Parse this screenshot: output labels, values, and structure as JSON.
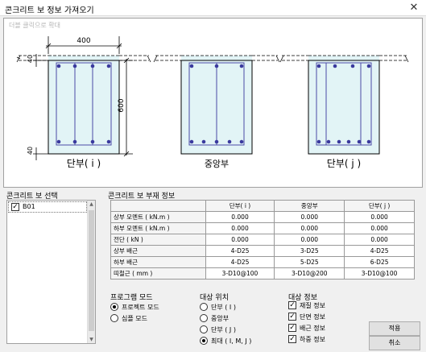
{
  "window": {
    "title": "콘크리트 보 정보 가져오기",
    "close_glyph": "✕"
  },
  "drawing": {
    "hint": "더블 클릭으로 확대",
    "sections": [
      {
        "label": "단부( i )"
      },
      {
        "label": "중앙부"
      },
      {
        "label": "단부( j )"
      }
    ],
    "dims": {
      "width": "400",
      "height": "600",
      "top_cover": "40",
      "bottom_cover": "40"
    }
  },
  "beam_select": {
    "title": "콘크리트 보 선택",
    "items": [
      {
        "label": "B01",
        "checked": true
      }
    ]
  },
  "member_info": {
    "title": "콘크리트 보 부재 정보",
    "columns": [
      "",
      "단부( i )",
      "중앙부",
      "단부( j )"
    ],
    "rows": [
      {
        "label": "상부 모멘트 ( kN.m )",
        "values": [
          "0.000",
          "0.000",
          "0.000"
        ]
      },
      {
        "label": "하부 모멘트 ( kN.m )",
        "values": [
          "0.000",
          "0.000",
          "0.000"
        ]
      },
      {
        "label": "전단 ( kN )",
        "values": [
          "0.000",
          "0.000",
          "0.000"
        ]
      },
      {
        "label": "상부 배근",
        "values": [
          "4-D25",
          "3-D25",
          "4-D25"
        ]
      },
      {
        "label": "하부 배근",
        "values": [
          "4-D25",
          "5-D25",
          "6-D25"
        ]
      },
      {
        "label": "띠철근 ( mm )",
        "values": [
          "3-D10@100",
          "3-D10@200",
          "3-D10@100"
        ]
      }
    ]
  },
  "program_mode": {
    "title": "프로그램 모드",
    "options": [
      {
        "label": "프로젝트 모드",
        "selected": true
      },
      {
        "label": "심플 모드",
        "selected": false
      }
    ]
  },
  "target_position": {
    "title": "대상 위치",
    "options": [
      {
        "label": "단부 ( I )",
        "selected": false
      },
      {
        "label": "중앙부",
        "selected": false
      },
      {
        "label": "단부 ( J )",
        "selected": false
      },
      {
        "label": "최대 ( I, M, J )",
        "selected": true
      }
    ]
  },
  "target_info": {
    "title": "대상 정보",
    "options": [
      {
        "label": "재질 정보",
        "checked": true
      },
      {
        "label": "단면 정보",
        "checked": true
      },
      {
        "label": "배근 정보",
        "checked": true
      },
      {
        "label": "하중 정보",
        "checked": true
      }
    ]
  },
  "buttons": {
    "apply": "적용",
    "cancel": "취소"
  },
  "icons": {
    "check": "✓"
  },
  "colors": {
    "section_fill": "#e2f4f6",
    "rebar": "#3a3a9e",
    "stirrup": "#4a4aa6"
  }
}
